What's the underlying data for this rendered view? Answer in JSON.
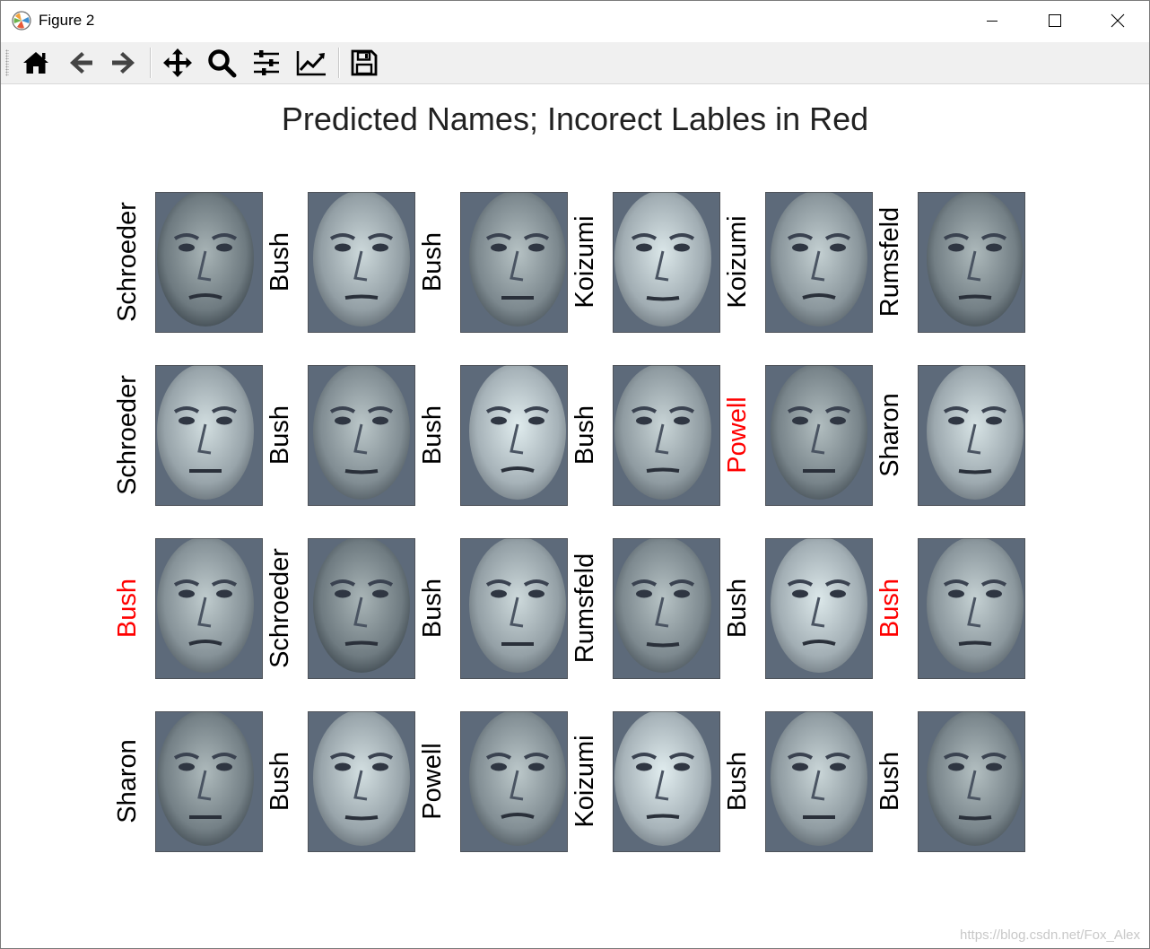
{
  "window": {
    "title": "Figure 2",
    "app_icon": "matplotlib-icon",
    "controls": [
      "minimize-icon",
      "maximize-icon",
      "close-icon"
    ]
  },
  "toolbar": {
    "tools": [
      {
        "name": "home-icon"
      },
      {
        "name": "back-arrow-icon"
      },
      {
        "name": "forward-arrow-icon"
      },
      {
        "name": "pan-icon"
      },
      {
        "name": "zoom-icon"
      },
      {
        "name": "configure-subplots-icon"
      },
      {
        "name": "edit-axis-icon"
      },
      {
        "name": "save-icon"
      }
    ]
  },
  "figure": {
    "title": "Predicted Names; Incorect Lables in Red",
    "colors": {
      "correct": "#000000",
      "incorrect": "#ff0000"
    },
    "grid": [
      [
        {
          "label": "Schroeder",
          "correct": true
        },
        {
          "label": "Bush",
          "correct": true
        },
        {
          "label": "Bush",
          "correct": true
        },
        {
          "label": "Koizumi",
          "correct": true
        },
        {
          "label": "Koizumi",
          "correct": true
        },
        {
          "label": "Rumsfeld",
          "correct": true
        }
      ],
      [
        {
          "label": "Schroeder",
          "correct": true
        },
        {
          "label": "Bush",
          "correct": true
        },
        {
          "label": "Bush",
          "correct": true
        },
        {
          "label": "Bush",
          "correct": true
        },
        {
          "label": "Powell",
          "correct": false
        },
        {
          "label": "Sharon",
          "correct": true
        }
      ],
      [
        {
          "label": "Bush",
          "correct": false
        },
        {
          "label": "Schroeder",
          "correct": true
        },
        {
          "label": "Bush",
          "correct": true
        },
        {
          "label": "Rumsfeld",
          "correct": true
        },
        {
          "label": "Bush",
          "correct": true
        },
        {
          "label": "Bush",
          "correct": false
        }
      ],
      [
        {
          "label": "Sharon",
          "correct": true
        },
        {
          "label": "Bush",
          "correct": true
        },
        {
          "label": "Powell",
          "correct": true
        },
        {
          "label": "Koizumi",
          "correct": true
        },
        {
          "label": "Bush",
          "correct": true
        },
        {
          "label": "Bush",
          "correct": true
        }
      ]
    ]
  },
  "watermark": "https://blog.csdn.net/Fox_Alex"
}
